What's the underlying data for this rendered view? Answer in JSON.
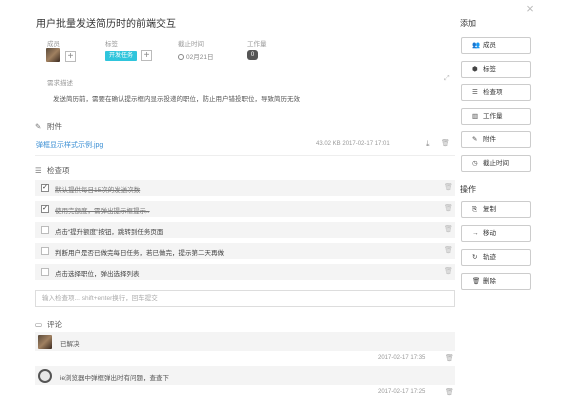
{
  "dialog": {
    "title": "用户批量发送简历时的前端交互",
    "close": "×"
  },
  "meta": {
    "labels": {
      "member": "成员",
      "tag": "标签",
      "due": "截止时间",
      "workload": "工作量"
    },
    "tag_value": "开发任务",
    "due_value": "02月21日",
    "workload_value": "0",
    "plus": "+"
  },
  "description": {
    "label": "需求描述",
    "text": "发送简历前，需要在确认提示框内显示投递的职位，防止用户错投职位，导致简历无效",
    "expand_icon": "⤢"
  },
  "attachments": {
    "heading": "附件",
    "file_name": "弹框显示样式示例.jpg",
    "file_meta": "43.02 KB  2017-02-17 17:01",
    "download_icon": "⤓",
    "delete_icon": "🗑"
  },
  "checklist": {
    "heading": "检查项",
    "items": [
      {
        "text": "默认提供每日15次的发送次数",
        "done": true
      },
      {
        "text": "使用完额度，需弹出提示框提示..",
        "done": true
      },
      {
        "text": "点击“提升额度”按钮，跳转到任务页面",
        "done": false
      },
      {
        "text": "判断用户是否已做完每日任务，若已做完，提示第二天再做",
        "done": false
      },
      {
        "text": "点击选择职位，弹出选择列表",
        "done": false
      }
    ],
    "input_placeholder": "输入检查项... shift+enter换行，回车提交"
  },
  "comments": {
    "heading": "评论",
    "items": [
      {
        "text": "已解决",
        "time": "2017-02-17 17:35"
      },
      {
        "text": "ie浏览器中弹框弹出时有问题，查查下",
        "time": "2017-02-17 17:25"
      }
    ]
  },
  "sidebar": {
    "add_heading": "添加",
    "add_buttons": [
      {
        "label": "成员",
        "icon": "member-icon",
        "glyph": "👥"
      },
      {
        "label": "标签",
        "icon": "tag-icon",
        "glyph": "⬢"
      },
      {
        "label": "检查项",
        "icon": "checklist-icon",
        "glyph": "☰"
      },
      {
        "label": "工作量",
        "icon": "workload-icon",
        "glyph": "▥"
      },
      {
        "label": "附件",
        "icon": "paperclip-icon",
        "glyph": "✎"
      },
      {
        "label": "截止时间",
        "icon": "clock-icon",
        "glyph": "◷"
      }
    ],
    "ops_heading": "操作",
    "op_buttons": [
      {
        "label": "复制",
        "icon": "copy-icon",
        "glyph": "⎘"
      },
      {
        "label": "移动",
        "icon": "arrow-right-icon",
        "glyph": "→"
      },
      {
        "label": "轨迹",
        "icon": "history-icon",
        "glyph": "↻"
      },
      {
        "label": "删除",
        "icon": "trash-icon",
        "glyph": "🗑"
      }
    ]
  },
  "colors": {
    "tag": "#2fc5dc",
    "link": "#3b8fd4"
  }
}
